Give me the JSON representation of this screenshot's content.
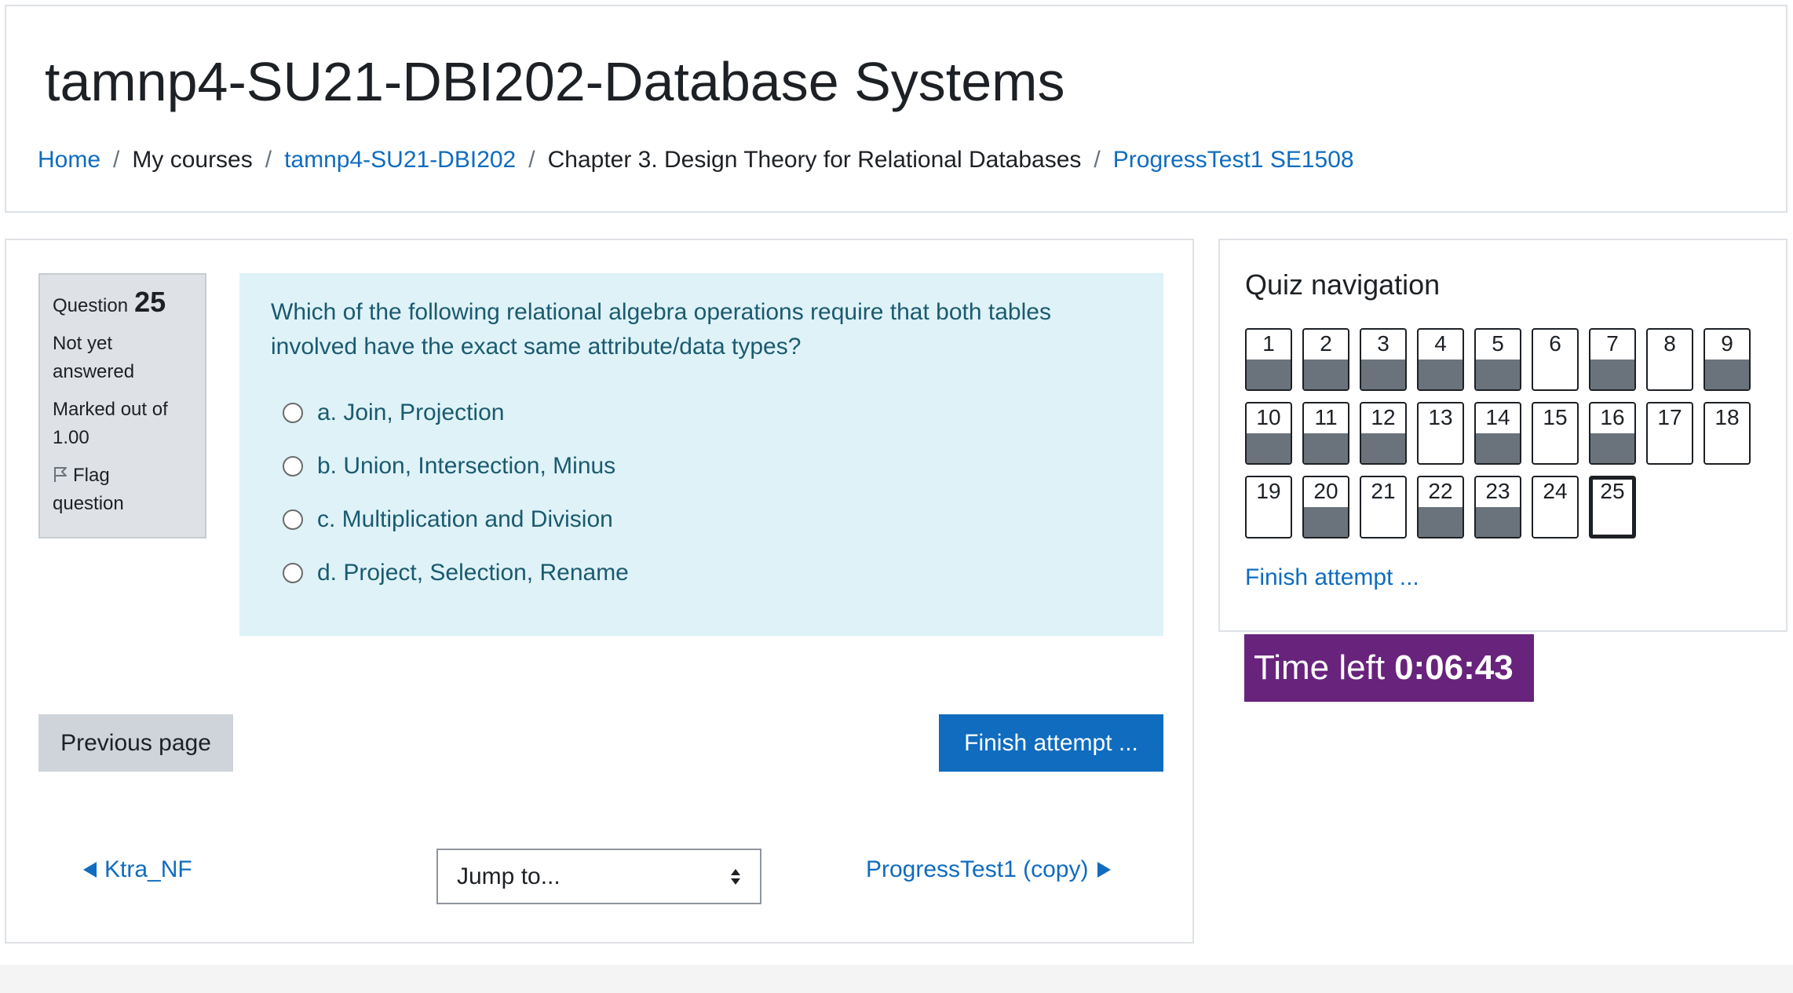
{
  "header": {
    "title": "tamnp4-SU21-DBI202-Database Systems",
    "breadcrumb": [
      {
        "label": "Home"
      },
      {
        "label": "My courses"
      },
      {
        "label": "tamnp4-SU21-DBI202"
      },
      {
        "label": "Chapter 3. Design Theory for Relational Databases"
      },
      {
        "label": "ProgressTest1 SE1508"
      }
    ],
    "separator": "/"
  },
  "question": {
    "label": "Question",
    "number": "25",
    "state_line1": "Not yet",
    "state_line2": "answered",
    "grade_line1": "Marked out of",
    "grade_line2": "1.00",
    "flag_line1": "Flag",
    "flag_line2": "question",
    "text_line1": "Which of the following relational algebra operations require that both tables",
    "text_line2": "involved have the exact same attribute/data types?",
    "answers": [
      {
        "label": "a. Join, Projection"
      },
      {
        "label": "b. Union, Intersection, Minus"
      },
      {
        "label": "c. Multiplication and Division"
      },
      {
        "label": "d. Project, Selection, Rename"
      }
    ]
  },
  "buttons": {
    "previous": "Previous page",
    "finish": "Finish attempt ..."
  },
  "activity_nav": {
    "prev_label": "Ktra_NF",
    "jump_placeholder": "Jump to...",
    "next_label": "ProgressTest1 (copy)"
  },
  "quiz_nav": {
    "title": "Quiz navigation",
    "finish_link": "Finish attempt ...",
    "questions": [
      {
        "n": "1",
        "answered": true
      },
      {
        "n": "2",
        "answered": true
      },
      {
        "n": "3",
        "answered": true
      },
      {
        "n": "4",
        "answered": true
      },
      {
        "n": "5",
        "answered": true
      },
      {
        "n": "6",
        "answered": false
      },
      {
        "n": "7",
        "answered": true
      },
      {
        "n": "8",
        "answered": false
      },
      {
        "n": "9",
        "answered": true
      },
      {
        "n": "10",
        "answered": true
      },
      {
        "n": "11",
        "answered": true
      },
      {
        "n": "12",
        "answered": true
      },
      {
        "n": "13",
        "answered": false
      },
      {
        "n": "14",
        "answered": true
      },
      {
        "n": "15",
        "answered": false
      },
      {
        "n": "16",
        "answered": true
      },
      {
        "n": "17",
        "answered": false
      },
      {
        "n": "18",
        "answered": false
      },
      {
        "n": "19",
        "answered": false
      },
      {
        "n": "20",
        "answered": true
      },
      {
        "n": "21",
        "answered": false
      },
      {
        "n": "22",
        "answered": true
      },
      {
        "n": "23",
        "answered": true
      },
      {
        "n": "24",
        "answered": false
      },
      {
        "n": "25",
        "answered": false,
        "current": true
      }
    ]
  },
  "timer": {
    "label": "Time left",
    "value": "0:06:43"
  },
  "colors": {
    "link": "#0f6cbf",
    "primary_button": "#0f6cbf",
    "timer_bg": "#68237c",
    "question_bg": "#def2f8",
    "answered_fill": "#6a737b"
  },
  "icons": {
    "flag": "flag-icon",
    "prev_arrow": "triangle-left-icon",
    "next_arrow": "triangle-right-icon",
    "select_arrows": "select-arrows-icon"
  }
}
